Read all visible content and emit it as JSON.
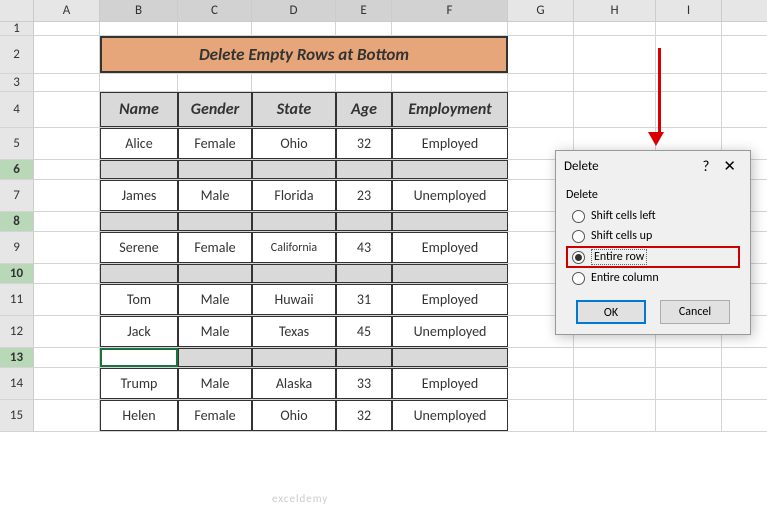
{
  "columns": [
    "A",
    "B",
    "C",
    "D",
    "E",
    "F",
    "G",
    "H",
    "I"
  ],
  "rows": [
    "1",
    "2",
    "3",
    "4",
    "5",
    "6",
    "7",
    "8",
    "9",
    "10",
    "11",
    "12",
    "13",
    "14",
    "15"
  ],
  "columnWidths": [
    "wA",
    "wB",
    "wC",
    "wD",
    "wE",
    "wF",
    "wG",
    "wH",
    "wI"
  ],
  "selectedCols": [
    "B",
    "C",
    "D",
    "E",
    "F"
  ],
  "selectedRows": [
    "6",
    "8",
    "10",
    "13"
  ],
  "title": "Delete Empty Rows at Bottom",
  "headers": {
    "name": "Name",
    "gender": "Gender",
    "state": "State",
    "age": "Age",
    "emp": "Employment"
  },
  "data": [
    {
      "name": "Alice",
      "gender": "Female",
      "state": "Ohio",
      "age": "32",
      "emp": "Employed"
    },
    {
      "name": "James",
      "gender": "Male",
      "state": "Florida",
      "age": "23",
      "emp": "Unemployed"
    },
    {
      "name": "Serene",
      "gender": "Female",
      "state": "California",
      "age": "43",
      "emp": "Employed"
    },
    {
      "name": "Tom",
      "gender": "Male",
      "state": "Huwaii",
      "age": "31",
      "emp": "Employed"
    },
    {
      "name": "Jack",
      "gender": "Male",
      "state": "Texas",
      "age": "45",
      "emp": "Unemployed"
    },
    {
      "name": "Trump",
      "gender": "Male",
      "state": "Alaska",
      "age": "33",
      "emp": "Employed"
    },
    {
      "name": "Helen",
      "gender": "Female",
      "state": "Ohio",
      "age": "32",
      "emp": "Unemployed"
    }
  ],
  "dialog": {
    "title": "Delete",
    "group": "Delete",
    "options": {
      "left": "Shift cells left",
      "up": "Shift cells up",
      "row": "Entire row",
      "col": "Entire column"
    },
    "selected": "row",
    "ok": "OK",
    "cancel": "Cancel"
  },
  "watermark": "exceldemy"
}
